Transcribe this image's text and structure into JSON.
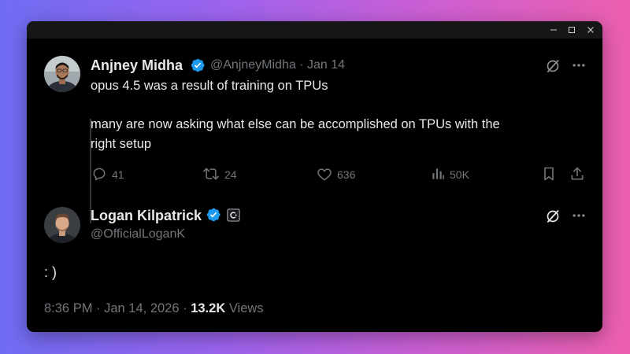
{
  "window": {
    "controls": [
      "minimize",
      "maximize",
      "close"
    ]
  },
  "tweet1": {
    "name": "Anjney Midha",
    "handle": "@AnjneyMidha",
    "sep": "·",
    "date": "Jan 14",
    "line1": "opus 4.5 was a result of training on TPUs",
    "line2": "many are now asking what else can be accomplished on TPUs with the",
    "line3": "right setup",
    "actions": {
      "replies": "41",
      "reposts": "24",
      "likes": "636",
      "views": "50K"
    }
  },
  "tweet2": {
    "name": "Logan Kilpatrick",
    "handle": "@OfficialLoganK",
    "text": ": )",
    "timestamp": "8:36 PM · Jan 14, 2026 · ",
    "views_count": "13.2K",
    "views_label": " Views"
  },
  "colors": {
    "verified": "#1d9bf0",
    "muted": "#71767b",
    "text": "#e7e9ea",
    "background": "#000000"
  }
}
